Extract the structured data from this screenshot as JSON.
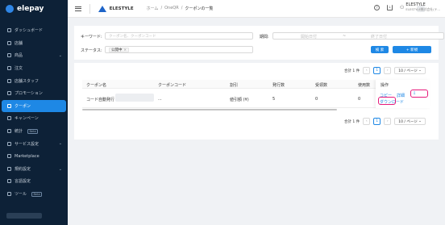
{
  "brand": {
    "name": "elepay"
  },
  "sidebar": {
    "items": [
      {
        "label": "ダッシュボード"
      },
      {
        "label": "店舗"
      },
      {
        "label": "商品"
      },
      {
        "label": "注文"
      },
      {
        "label": "店舗スタッフ"
      },
      {
        "label": "プロモーション"
      },
      {
        "label": "クーポン"
      },
      {
        "label": "キャンペーン"
      },
      {
        "label": "統計",
        "badge": "Beta"
      },
      {
        "label": "サービス設定"
      },
      {
        "label": "Marketplace"
      },
      {
        "label": "規約設定"
      },
      {
        "label": "言語設定"
      },
      {
        "label": "ツール",
        "badge": "Beta"
      }
    ]
  },
  "header": {
    "store": "ELESTYLE",
    "breadcrumbs": [
      "ホーム",
      "/",
      "OneQR",
      "/",
      "クーポンの一覧"
    ],
    "user_name": "ELESTYLE",
    "user_org": "ELESTYLE株式会社(テ..."
  },
  "filter": {
    "keyword_label": "キーワード:",
    "keyword_placeholder": "クーポン名、クーポンコード",
    "period_label": "期間:",
    "start_placeholder": "開始日付",
    "date_sep": "~",
    "end_placeholder": "終了日付",
    "status_label": "ステータス:",
    "status_tag": "公開中",
    "search_button": "検 索",
    "new_button": "+ 新規"
  },
  "list": {
    "total_text": "合計 1 件",
    "page": "1",
    "page_size": "10 / ページ",
    "columns": [
      "クーポン名",
      "クーポンコード",
      "割引",
      "発行数",
      "受領数",
      "使用数",
      "操作"
    ],
    "rows": [
      {
        "name": "コード自動発行",
        "code": "...",
        "discount": "値引額 (¥)",
        "issued": "5",
        "received": "0",
        "used": "0"
      }
    ],
    "actions": {
      "copy": "コピー",
      "detail": "詳細",
      "download": "ダウンロード",
      "download_icon": "download-icon"
    }
  },
  "colors": {
    "sidebar_bg": "#0d2137",
    "accent": "#1e88e5",
    "highlight_ring": "#e6197a"
  }
}
